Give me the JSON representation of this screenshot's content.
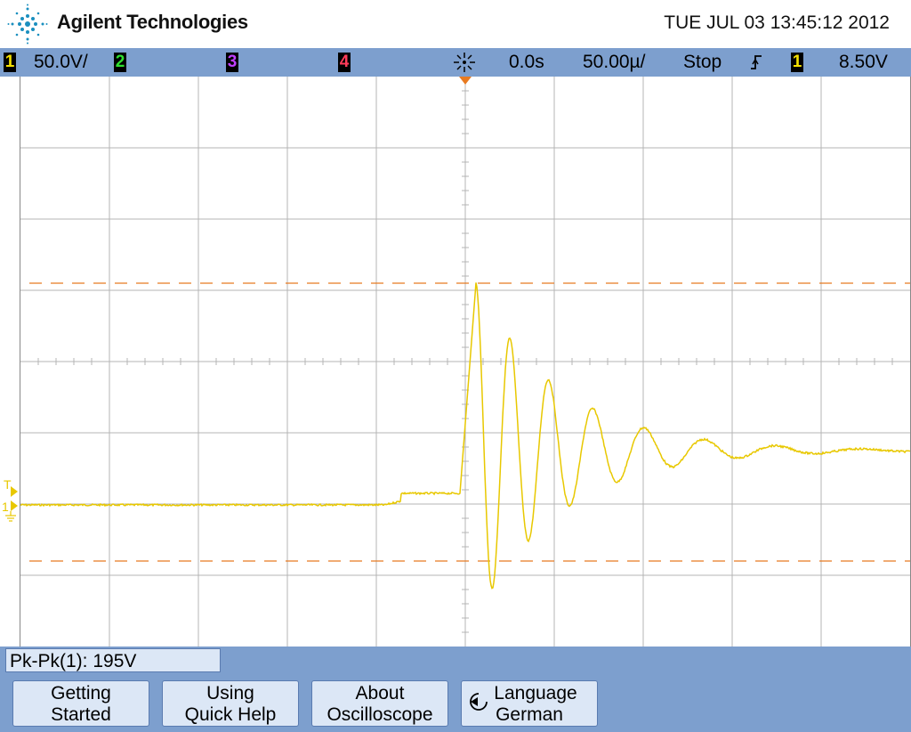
{
  "header": {
    "brand": "Agilent Technologies",
    "datetime": "TUE JUL 03 13:45:12 2012"
  },
  "status_bar": {
    "ch1_number": "1",
    "ch1_scale": "50.0V/",
    "ch2_number": "2",
    "ch3_number": "3",
    "ch4_number": "4",
    "delay": "0.0s",
    "timebase": "50.00µ/",
    "run_state": "Stop",
    "trigger_slope_icon": "rising-edge-icon",
    "trigger_source": "1",
    "trigger_level": "8.50V",
    "colors": {
      "ch1": "#f5e100",
      "ch2": "#2fe02f",
      "ch3": "#c040ff",
      "ch4": "#ff3c5a",
      "trace": "#e8c800",
      "cursor": "#e87a20"
    }
  },
  "screen": {
    "trigger_marker": "T",
    "ch1_ground_marker": "1"
  },
  "measurement": {
    "label": "Pk-Pk(1):",
    "value": "195V"
  },
  "softkeys": [
    {
      "line1": "Getting",
      "line2": "Started"
    },
    {
      "line1": "Using",
      "line2": "Quick Help"
    },
    {
      "line1": "About",
      "line2": "Oscilloscope"
    },
    {
      "line1": "Language",
      "line2": "German",
      "icon": "cycle-arrow-icon"
    }
  ]
}
